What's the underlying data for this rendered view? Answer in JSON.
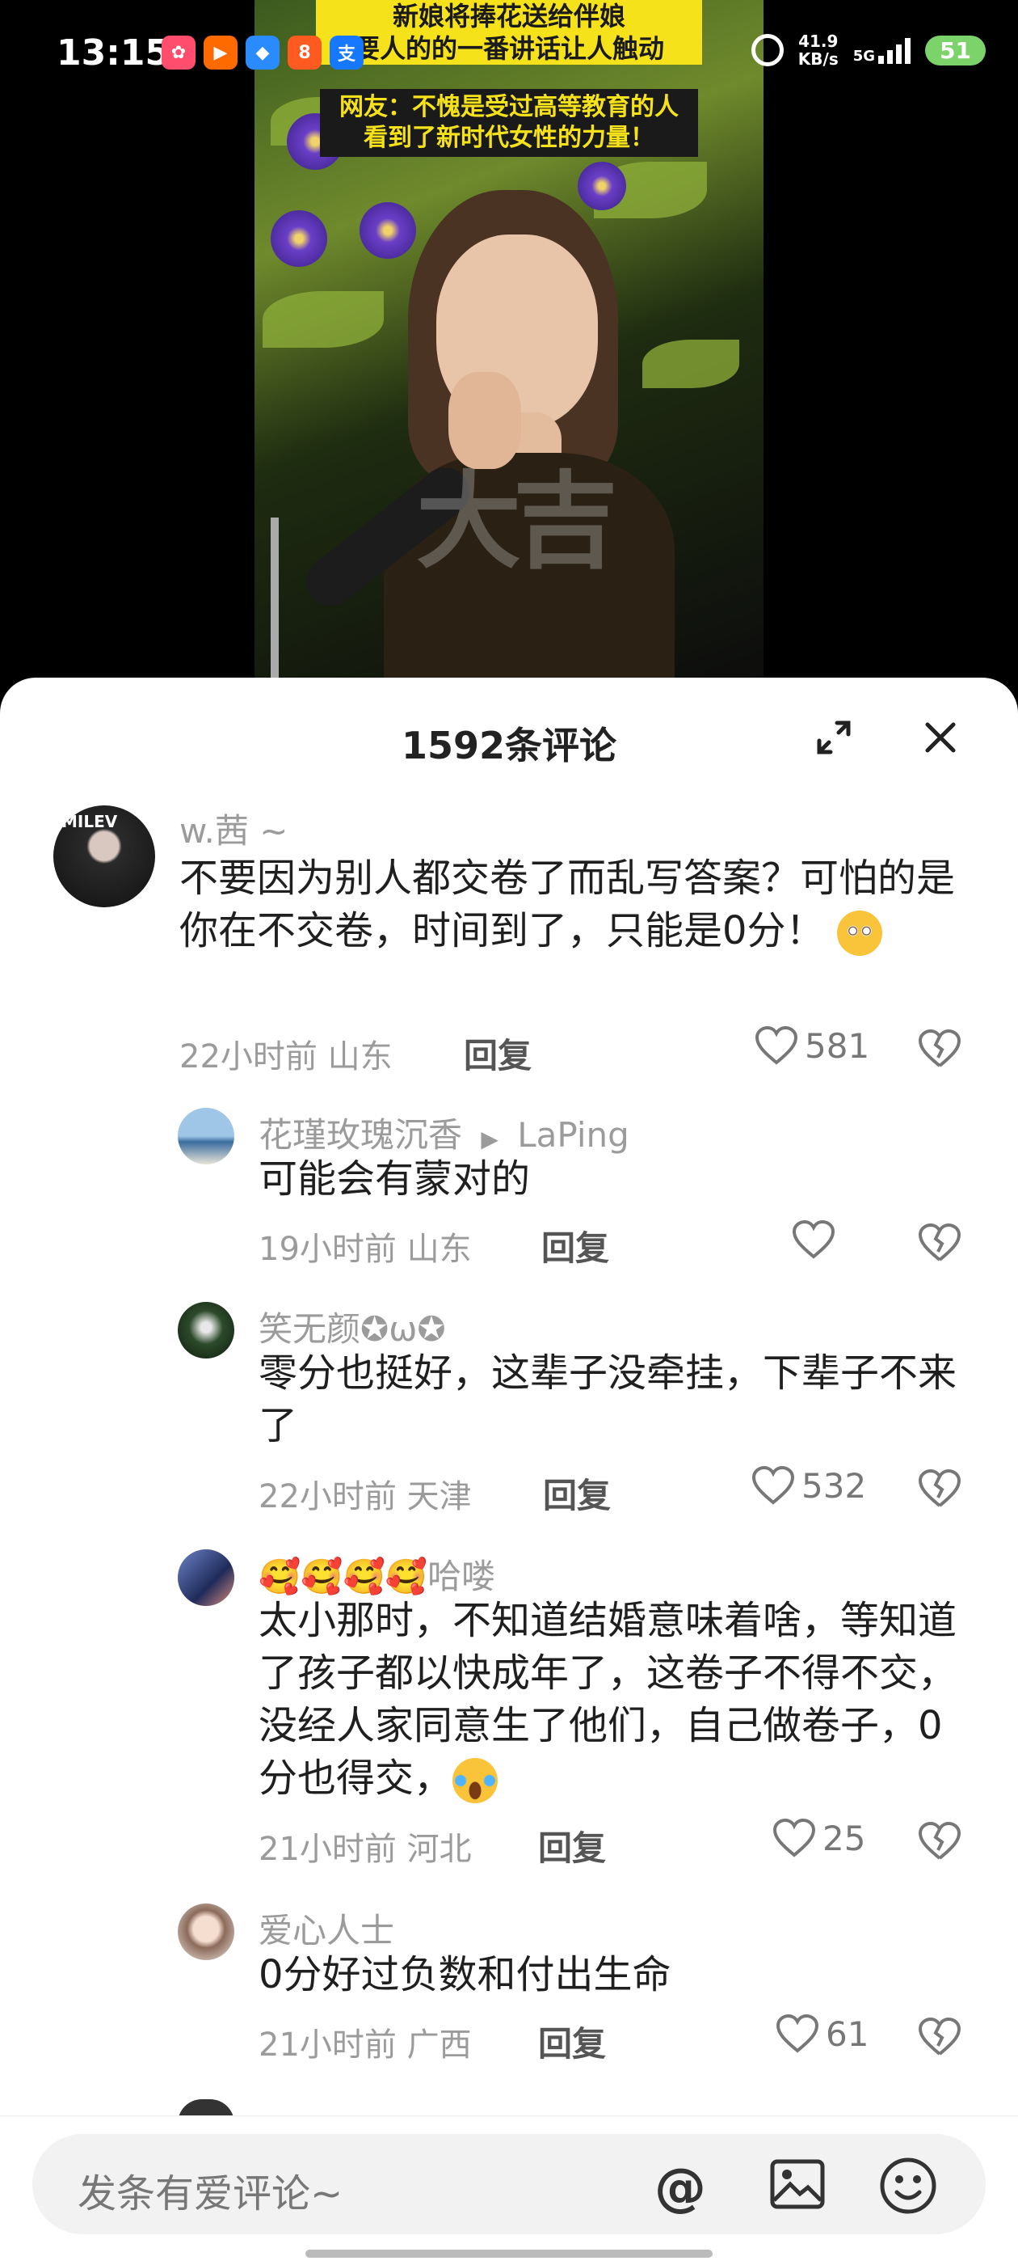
{
  "status_bar": {
    "time": "13:15",
    "apps": [
      {
        "icon": "pinwheel-app-icon",
        "color": "#ff4d6d",
        "glyph": "✿"
      },
      {
        "icon": "video-app-icon",
        "color": "#ff6a00",
        "glyph": "▶"
      },
      {
        "icon": "drive-app-icon",
        "color": "#2a8bff",
        "glyph": "◆"
      },
      {
        "icon": "app-88-icon",
        "color": "#ff5a1f",
        "glyph": "8"
      },
      {
        "icon": "alipay-icon",
        "color": "#1677ff",
        "glyph": "支"
      }
    ],
    "net_speed": "41.9",
    "net_unit": "KB/s",
    "network": "5G",
    "battery": "51"
  },
  "video": {
    "caption_line1": "新娘将捧花送给伴娘",
    "caption_line2": "要人的的一番讲话让人触动",
    "caption_line3": "网友：不愧是受过高等教育的人",
    "caption_line4": "看到了新时代女性的力量！",
    "watermark": "大吉"
  },
  "comments_panel": {
    "title": "1592条评论",
    "comments": [
      {
        "user": "w.茜 ~",
        "text": "不要因为别人都交卷了而乱写答案？可怕的是你在不交卷，时间到了，只能是0分！",
        "time_loc": "22小时前 山东",
        "reply": "回复",
        "likes": "581"
      },
      {
        "user": "花瑾玫瑰沉香",
        "reply_to": "LaPing",
        "text": "可能会有蒙对的",
        "time_loc": "19小时前 山东",
        "reply": "回复",
        "likes": ""
      },
      {
        "user": "笑无颜✪ω✪",
        "text": "零分也挺好，这辈子没牵挂，下辈子不来了",
        "time_loc": "22小时前 天津",
        "reply": "回复",
        "likes": "532"
      },
      {
        "user": "🥰🥰🥰🥰哈喽",
        "text": "太小那时，不知道结婚意味着啥，等知道了孩子都以快成年了，这卷子不得不交，没经人家同意生了他们，自己做卷子，0分也得交，",
        "time_loc": "21小时前 河北",
        "reply": "回复",
        "likes": "25"
      },
      {
        "user": "爱心人士",
        "text": "0分好过负数和付出生命",
        "time_loc": "21小时前 广西",
        "reply": "回复",
        "likes": "61"
      }
    ]
  },
  "input_bar": {
    "placeholder": "发条有爱评论~",
    "at_symbol": "@"
  }
}
